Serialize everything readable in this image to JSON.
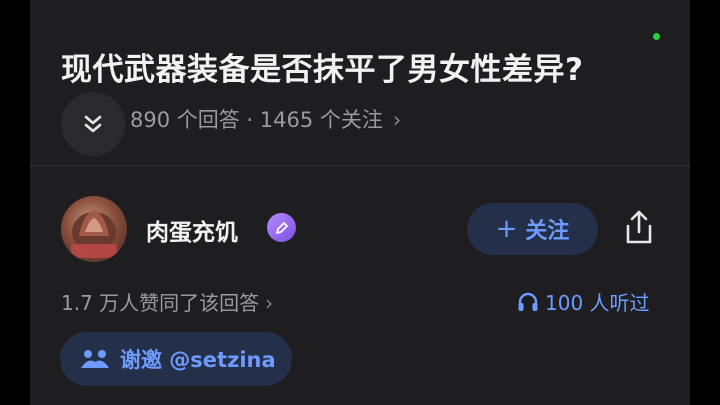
{
  "question": {
    "title": "现代武器装备是否抹平了男女性差异?",
    "meta": "890 个回答 · 1465 个关注",
    "chevron": "›"
  },
  "answer": {
    "author": "肉蛋充饥",
    "follow_label": "关注",
    "follow_plus": "+",
    "likes": "1.7 万人赞同了该回答",
    "likes_chevron": "›",
    "listened": "100 人听过",
    "invite": "谢邀 @setzina"
  },
  "colors": {
    "background": "#1e1e21",
    "accent": "#6e9bff",
    "button_bg": "#243049",
    "status_dot": "#2ecc40"
  },
  "icons": [
    "collapse-chevron-icon",
    "creator-badge-icon",
    "share-icon",
    "headphones-icon",
    "invite-icon"
  ]
}
